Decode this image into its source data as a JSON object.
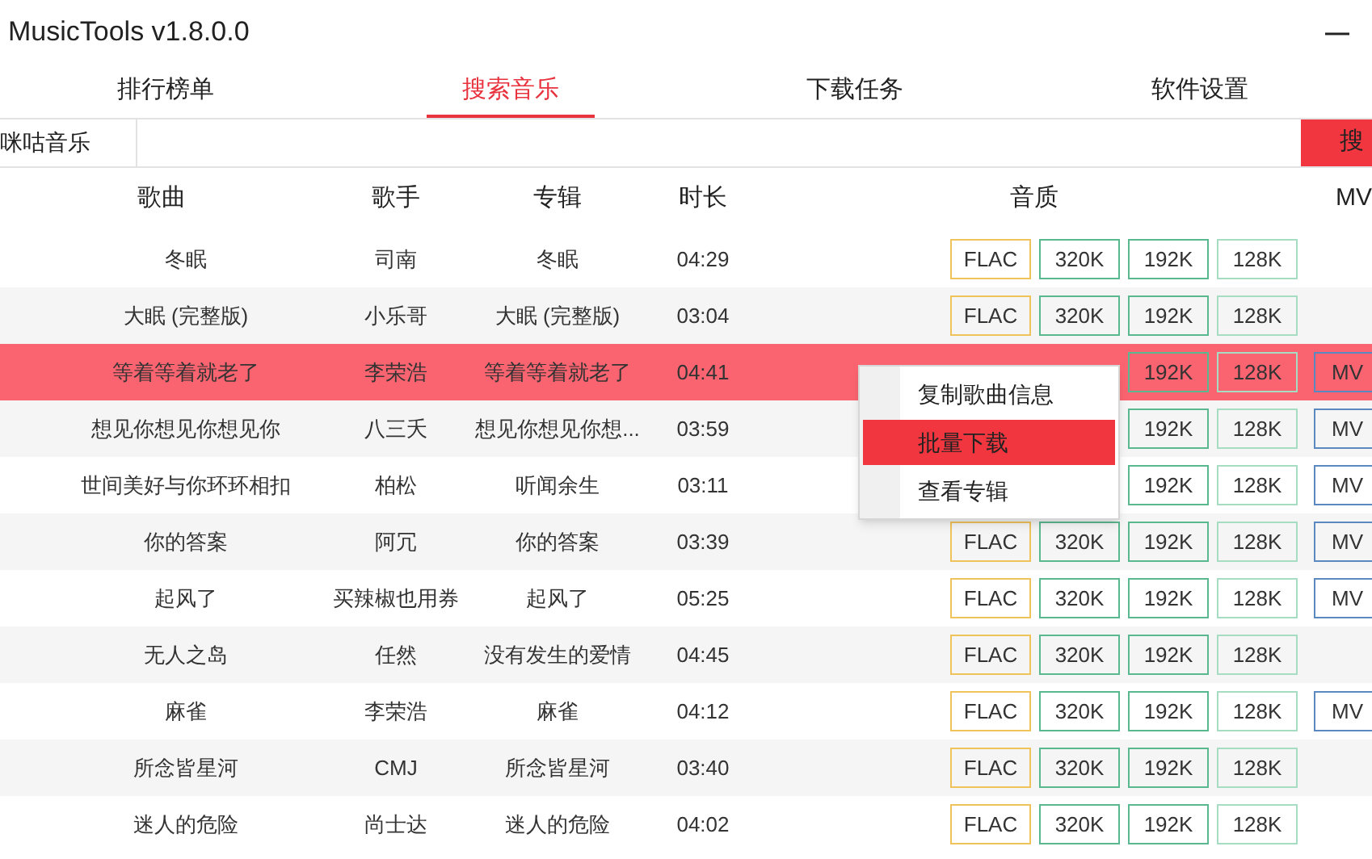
{
  "window": {
    "title": "MusicTools v1.8.0.0",
    "minimize": "—"
  },
  "tabs": [
    {
      "label": "排行榜单",
      "selected": false
    },
    {
      "label": "搜索音乐",
      "selected": true
    },
    {
      "label": "下载任务",
      "selected": false
    },
    {
      "label": "软件设置",
      "selected": false
    }
  ],
  "search": {
    "source": "咪咕音乐",
    "button": "搜"
  },
  "table": {
    "columns": [
      "歌曲",
      "歌手",
      "专辑",
      "时长",
      "音质",
      "MV"
    ],
    "rows": [
      {
        "song": "冬眠",
        "singer": "司南",
        "album": "冬眠",
        "duration": "04:29",
        "qualities": [
          {
            "label": "FLAC",
            "kind": "flac"
          },
          {
            "label": "320K",
            "kind": "high"
          },
          {
            "label": "192K",
            "kind": "high"
          },
          {
            "label": "128K",
            "kind": "low"
          }
        ],
        "selected": false
      },
      {
        "song": "大眠 (完整版)",
        "singer": "小乐哥",
        "album": "大眠 (完整版)",
        "duration": "03:04",
        "qualities": [
          {
            "label": "FLAC",
            "kind": "flac"
          },
          {
            "label": "320K",
            "kind": "high"
          },
          {
            "label": "192K",
            "kind": "high"
          },
          {
            "label": "128K",
            "kind": "low"
          }
        ],
        "selected": false
      },
      {
        "song": "等着等着就老了",
        "singer": "李荣浩",
        "album": "等着等着就老了",
        "duration": "04:41",
        "qualities": [
          {
            "label": "192K",
            "kind": "high"
          },
          {
            "label": "128K",
            "kind": "low"
          }
        ],
        "mv": "MV",
        "selected": true
      },
      {
        "song": "想见你想见你想见你",
        "singer": "八三夭",
        "album": "想见你想见你想...",
        "duration": "03:59",
        "qualities": [
          {
            "label": "192K",
            "kind": "high"
          },
          {
            "label": "128K",
            "kind": "low"
          }
        ],
        "mv": "MV",
        "selected": false
      },
      {
        "song": "世间美好与你环环相扣",
        "singer": "柏松",
        "album": "听闻余生",
        "duration": "03:11",
        "qualities": [
          {
            "label": "192K",
            "kind": "high"
          },
          {
            "label": "128K",
            "kind": "low"
          }
        ],
        "mv": "MV",
        "selected": false
      },
      {
        "song": "你的答案",
        "singer": "阿冗",
        "album": "你的答案",
        "duration": "03:39",
        "qualities": [
          {
            "label": "FLAC",
            "kind": "flac"
          },
          {
            "label": "320K",
            "kind": "high"
          },
          {
            "label": "192K",
            "kind": "high"
          },
          {
            "label": "128K",
            "kind": "low"
          }
        ],
        "mv": "MV",
        "selected": false
      },
      {
        "song": "起风了",
        "singer": "买辣椒也用券",
        "album": "起风了",
        "duration": "05:25",
        "qualities": [
          {
            "label": "FLAC",
            "kind": "flac"
          },
          {
            "label": "320K",
            "kind": "high"
          },
          {
            "label": "192K",
            "kind": "high"
          },
          {
            "label": "128K",
            "kind": "low"
          }
        ],
        "mv": "MV",
        "selected": false
      },
      {
        "song": "无人之岛",
        "singer": "任然",
        "album": "没有发生的爱情",
        "duration": "04:45",
        "qualities": [
          {
            "label": "FLAC",
            "kind": "flac"
          },
          {
            "label": "320K",
            "kind": "high"
          },
          {
            "label": "192K",
            "kind": "high"
          },
          {
            "label": "128K",
            "kind": "low"
          }
        ],
        "selected": false
      },
      {
        "song": "麻雀",
        "singer": "李荣浩",
        "album": "麻雀",
        "duration": "04:12",
        "qualities": [
          {
            "label": "FLAC",
            "kind": "flac"
          },
          {
            "label": "320K",
            "kind": "high"
          },
          {
            "label": "192K",
            "kind": "high"
          },
          {
            "label": "128K",
            "kind": "low"
          }
        ],
        "mv": "MV",
        "selected": false
      },
      {
        "song": "所念皆星河",
        "singer": "CMJ",
        "album": "所念皆星河",
        "duration": "03:40",
        "qualities": [
          {
            "label": "FLAC",
            "kind": "flac"
          },
          {
            "label": "320K",
            "kind": "high"
          },
          {
            "label": "192K",
            "kind": "high"
          },
          {
            "label": "128K",
            "kind": "low"
          }
        ],
        "selected": false
      },
      {
        "song": "迷人的危险",
        "singer": "尚士达",
        "album": "迷人的危险",
        "duration": "04:02",
        "qualities": [
          {
            "label": "FLAC",
            "kind": "flac"
          },
          {
            "label": "320K",
            "kind": "high"
          },
          {
            "label": "192K",
            "kind": "high"
          },
          {
            "label": "128K",
            "kind": "low"
          }
        ],
        "selected": false
      }
    ]
  },
  "context_menu": {
    "items": [
      {
        "label": "复制歌曲信息",
        "selected": false
      },
      {
        "label": "批量下载",
        "selected": true
      },
      {
        "label": "查看专辑",
        "selected": false
      }
    ]
  }
}
